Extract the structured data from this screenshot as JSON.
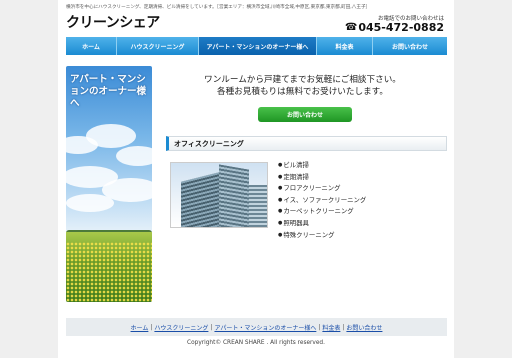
{
  "header": {
    "tagline": "横浜市を中心にハウスクリーニング、定期清掃、ビル清掃をしています。［営業エリア：横浜市全域,川崎市全域,中原区,東京都,東京都,町田,八王子］",
    "logo": "クリーンシェア",
    "contact_label": "お電話でのお問い合わせは",
    "phone_icon": "☎",
    "phone": "045-472-0882"
  },
  "nav": {
    "items": [
      {
        "label": "ホーム"
      },
      {
        "label": "ハウスクリーニング"
      },
      {
        "label": "アパート・マンションのオーナー様へ"
      },
      {
        "label": "料金表"
      },
      {
        "label": "お問い合わせ"
      }
    ],
    "active_index": 2
  },
  "hero": {
    "text": "アパート・マンションのオーナー様へ"
  },
  "main": {
    "lead_line1": "ワンルームから戸建てまでお気軽にご相談下さい。",
    "lead_line2": "各種お見積もりは無料でお受けいたします。",
    "contact_button": "お問い合わせ"
  },
  "office": {
    "title": "オフィスクリーニング",
    "services": [
      "ビル清掃",
      "定期清掃",
      "フロアクリーニング",
      "イス、ソファークリーニング",
      "カーペットクリーニング",
      "照明器具",
      "特殊クリーニング"
    ]
  },
  "footer": {
    "links": [
      "ホーム",
      "ハウスクリーニング",
      "アパート・マンションのオーナー様へ",
      "料金表",
      "お問い合わせ"
    ],
    "separator": "|",
    "copyright": "Copyright© CREAN SHARE . All rights reserved."
  },
  "colors": {
    "nav_blue": "#1b8bd2",
    "nav_active": "#0a62ad",
    "button_green": "#1f9624",
    "link_blue": "#1a4ea8"
  }
}
